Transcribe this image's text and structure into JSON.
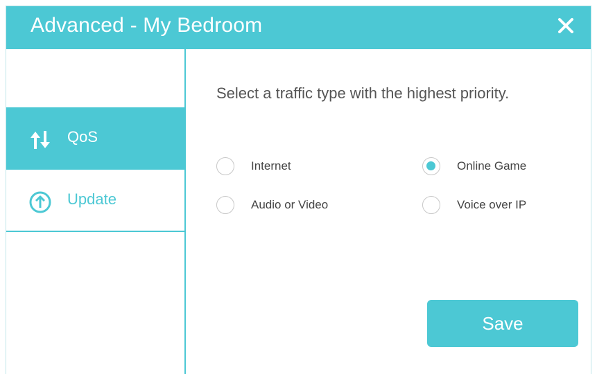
{
  "dialog": {
    "title": "Advanced - My Bedroom",
    "close_icon": "close-icon"
  },
  "sidebar": {
    "items": [
      {
        "label": "QoS",
        "icon": "sort-arrows-icon",
        "selected": true
      },
      {
        "label": "Update",
        "icon": "upload-circle-icon",
        "selected": false
      }
    ]
  },
  "qos": {
    "prompt": "Select a traffic type with the highest priority.",
    "options": [
      {
        "label": "Internet",
        "checked": false
      },
      {
        "label": "Online Game",
        "checked": true
      },
      {
        "label": "Audio or Video",
        "checked": false
      },
      {
        "label": "Voice over IP",
        "checked": false
      }
    ],
    "save_label": "Save"
  },
  "colors": {
    "accent": "#4cc8d4",
    "text": "#555555",
    "radio_border": "#c8c8c8"
  }
}
